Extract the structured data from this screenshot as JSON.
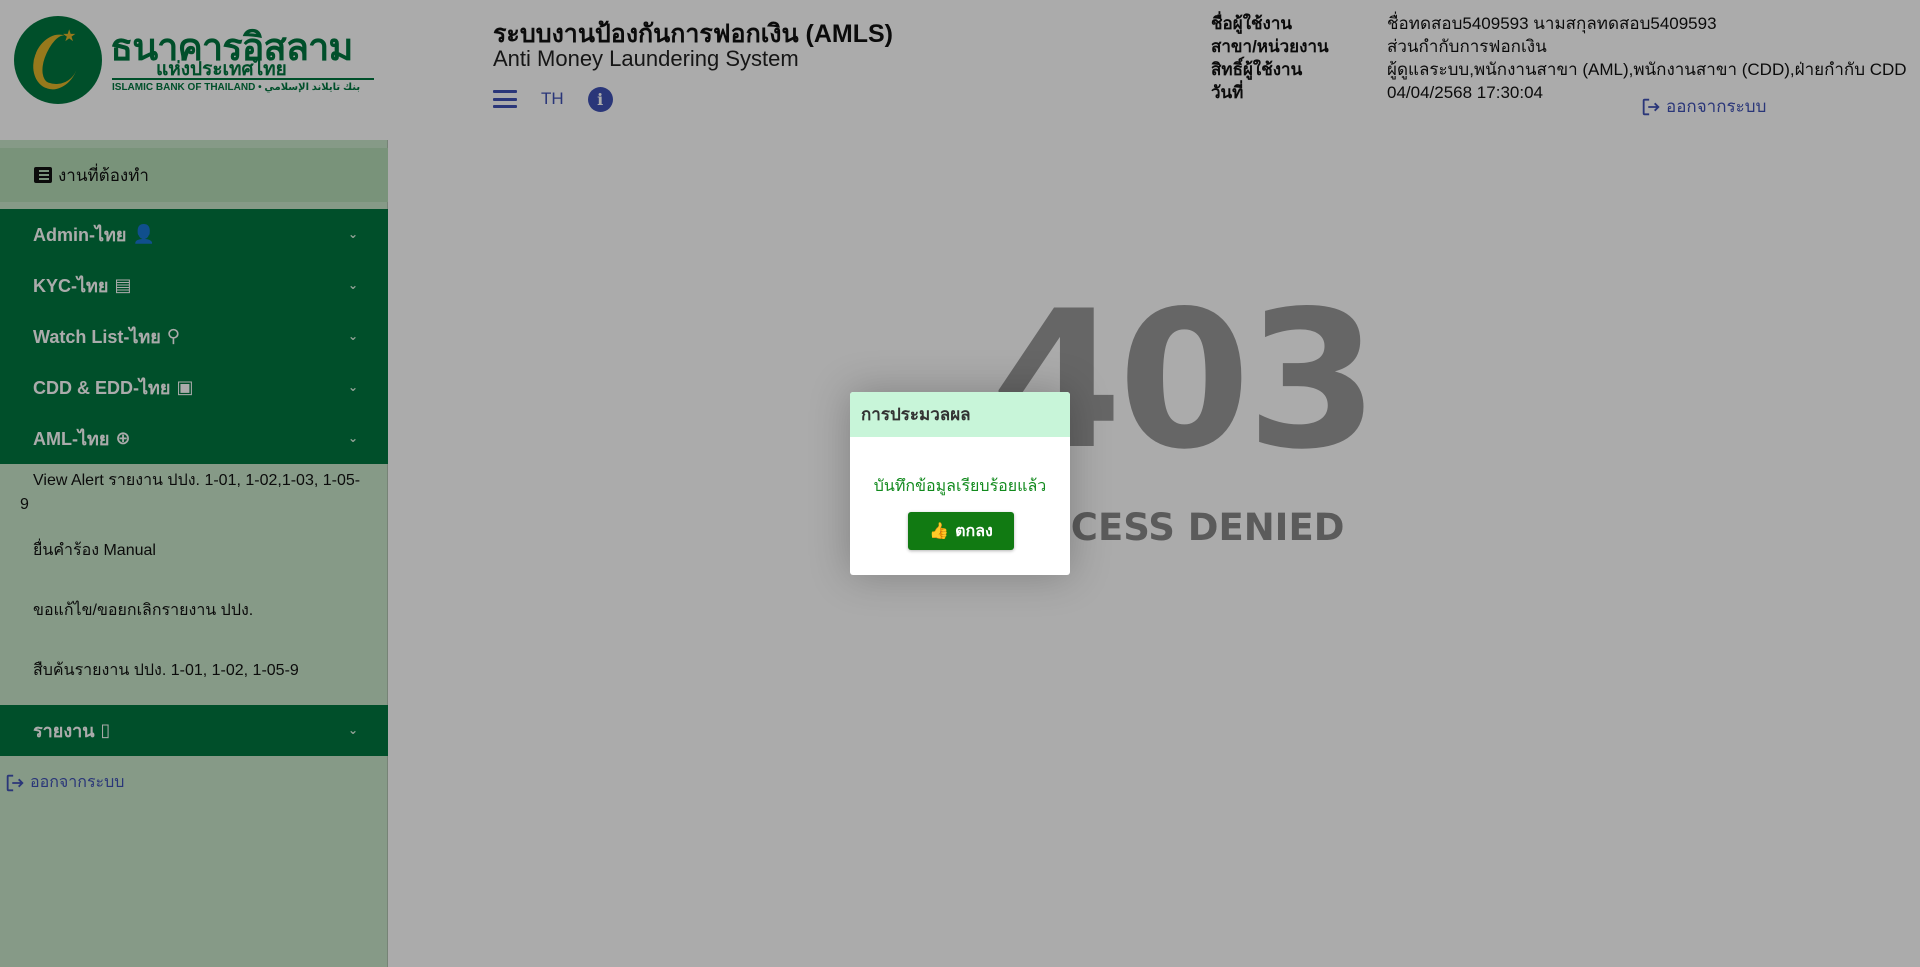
{
  "logo": {
    "name_th": "ธนาคารอิสลาม",
    "sub_th": "แห่งประเทศไทย",
    "name_en": "ISLAMIC BANK OF THAILAND • بنك تايلاند الإسلامي"
  },
  "header": {
    "title": "ระบบงานป้องกันการฟอกเงิน (AMLS)",
    "subtitle": "Anti Money Laundering System",
    "lang": "TH",
    "user_labels": [
      "ชื่อผู้ใช้งาน",
      "สาขา/หน่วยงาน",
      "สิทธิ์ผู้ใช้งาน",
      "วันที่"
    ],
    "user_values": [
      "ชื่อทดสอบ5409593 นามสกุลทดสอบ5409593",
      "ส่วนกำกับการฟอกเงิน",
      "ผู้ดูแลระบบ,พนักงานสาขา (AML),พนักงานสาขา (CDD),ฝ่ายกำกับ CDD",
      "04/04/2568 17:30:04"
    ],
    "logout": "ออกจากระบบ"
  },
  "sidebar": {
    "todo": "งานที่ต้องทำ",
    "menu": [
      {
        "label": "Admin-ไทย",
        "icon": "user-gear-icon"
      },
      {
        "label": "KYC-ไทย",
        "icon": "id-card-icon"
      },
      {
        "label": "Watch List-ไทย",
        "icon": "search-icon"
      },
      {
        "label": "CDD & EDD-ไทย",
        "icon": "id-badge-icon"
      },
      {
        "label": "AML-ไทย",
        "icon": "search-plus-icon"
      }
    ],
    "aml_sub": [
      "View Alert รายงาน ปปง. 1-01, 1-02,1-03, 1-05-9",
      "ยื่นคำร้อง Manual",
      "ขอแก้ไข/ขอยกเลิกรายงาน ปปง.",
      "สืบค้นรายงาน ปปง. 1-01, 1-02, 1-05-9"
    ],
    "report": {
      "label": "รายงาน",
      "icon": "tablet-icon"
    },
    "logout": "ออกจากระบบ"
  },
  "main": {
    "code": "403",
    "message": "ACCESS DENIED"
  },
  "modal": {
    "title": "การประมวลผล",
    "message": "บันทึกข้อมูลเรียบร้อยแล้ว",
    "ok": "ตกลง"
  },
  "colors": {
    "brand_green": "#00763f",
    "sidebar_bg": "#c8e6c9",
    "link_blue": "#3f51b5",
    "modal_header": "#c8f5d9",
    "ok_button": "#117a12"
  }
}
